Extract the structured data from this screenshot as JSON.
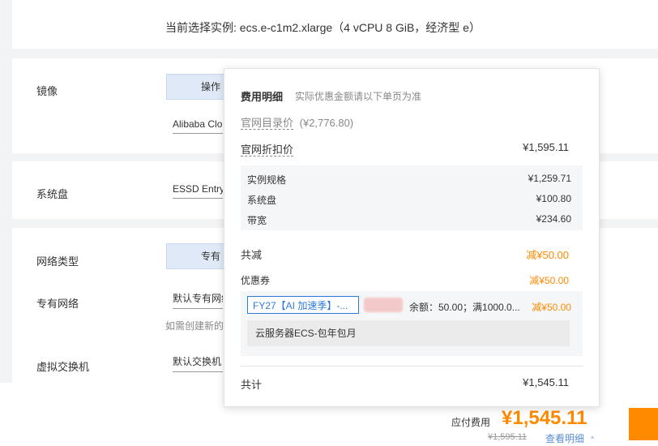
{
  "selected_instance_text": "当前选择实例: ecs.e-c1m2.xlarge（4 vCPU 8 GiB，经济型 e）",
  "image": {
    "label": "镜像",
    "tab_label": "操作",
    "select_value": "Alibaba Clo"
  },
  "system_disk": {
    "label": "系统盘",
    "select_value": "ESSD Entry"
  },
  "network": {
    "type_label": "网络类型",
    "type_btn": "专有",
    "vpc_label": "专有网络",
    "vpc_value": "默认专有网络",
    "vpc_hint": "如需创建新的",
    "vswitch_label": "虚拟交换机",
    "vswitch_value": "默认交换机"
  },
  "popover": {
    "title": "费用明细",
    "subtitle": "实际优惠金额请以下单页为准",
    "list_price_label": "官网目录价",
    "list_price_value": "(¥2,776.80)",
    "discount_label": "官网折扣价",
    "discount_value": "¥1,595.11",
    "details": [
      {
        "label": "实例规格",
        "value": "¥1,259.71"
      },
      {
        "label": "系统盘",
        "value": "¥100.80"
      },
      {
        "label": "带宽",
        "value": "¥234.60"
      }
    ],
    "total_reduce_label": "共减",
    "total_reduce_value": "减¥50.00",
    "coupon_label": "优惠券",
    "coupon_value": "减¥50.00",
    "coupon_select": "FY27【AI 加速季】-...",
    "coupon_desc": "余额：50.00；满1000.0...",
    "coupon_row_value": "减¥50.00",
    "coupon_product": "云服务器ECS-包年包月",
    "sum_label": "共计",
    "sum_value": "¥1,545.11"
  },
  "bottom": {
    "payable_label": "应付费用",
    "payable_value": "¥1,545.11",
    "original_value": "¥1,595.11",
    "view_details": "查看明细",
    "accent": "#ff8a00"
  }
}
